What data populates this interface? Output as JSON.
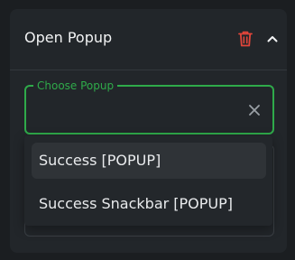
{
  "header": {
    "title": "Open Popup"
  },
  "field": {
    "label": "Choose Popup",
    "value": ""
  },
  "dropdown": {
    "options": [
      "Success [POPUP]",
      "Success Snackbar [POPUP]"
    ]
  },
  "colors": {
    "accent": "#2faa4a",
    "delete": "#e0453a"
  },
  "icons": {
    "delete": "trash-icon",
    "collapse": "chevron-up-icon",
    "clear": "close-icon"
  }
}
